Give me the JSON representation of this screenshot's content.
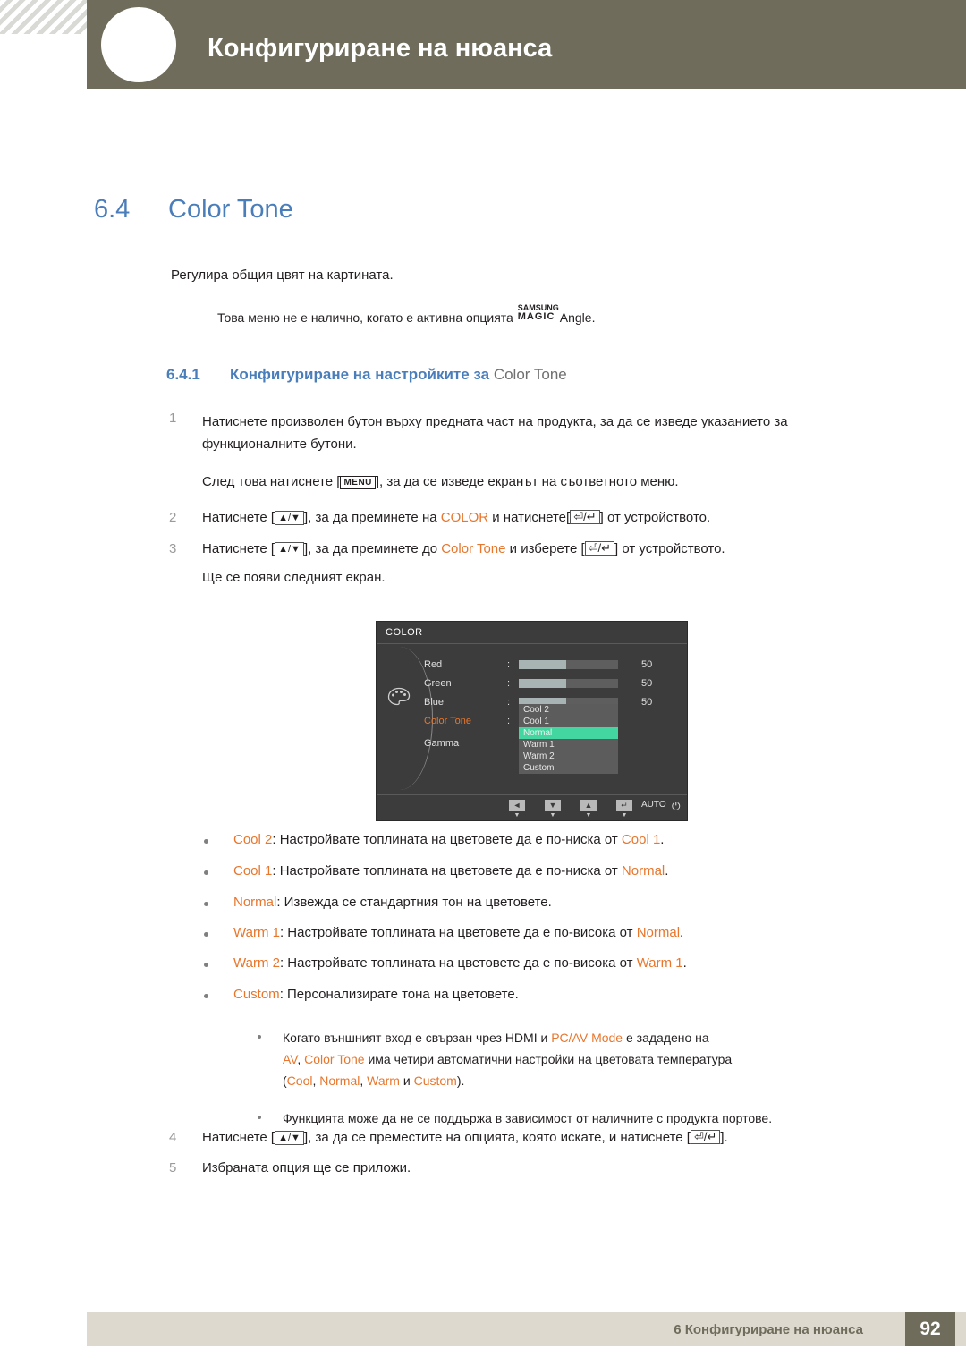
{
  "header": {
    "title": "Конфигуриране на нюанса",
    "icon": "chapter-circle-icon"
  },
  "section": {
    "number": "6.4",
    "title": "Color Tone"
  },
  "intro": "Регулира общия цвят на картината.",
  "note_magic": {
    "before": "Това меню не е налично, когато е активна опцията ",
    "logo_top": "SAMSUNG",
    "logo_bottom": "MAGIC",
    "after": "Angle",
    "period": "."
  },
  "subhead": {
    "number": "6.4.1",
    "bold": "Конфигуриране на настройките за ",
    "plain": "Color Tone"
  },
  "steps": [
    {
      "num": "1",
      "line1": "Натиснете произволен бутон върху предната част на продукта, за да се изведе указанието за",
      "line2": "функционалните бутони.",
      "line3_before": "След това натиснете [",
      "line3_key": "MENU",
      "line3_after": "], за да се изведе екранът на съответното меню."
    },
    {
      "num": "2",
      "before": "Натиснете [",
      "keys": "▲/▼",
      "mid": "], за да преминете на ",
      "highlight": "COLOR",
      "mid2": " и натиснете[",
      "after": "] от устройството."
    },
    {
      "num": "3",
      "before": "Натиснете [",
      "keys": "▲/▼",
      "mid": "], за да преминете до ",
      "highlight": "Color Tone",
      "mid2": " и изберете [",
      "after": "] от устройството.",
      "sub": "Ще се появи следният екран."
    },
    {
      "num": "4",
      "before": "Натиснете [",
      "keys": "▲/▼",
      "mid": "], за да се преместите на опцията, която искате, и натиснете [",
      "after": "]."
    },
    {
      "num": "5",
      "text": "Избраната опция ще се приложи."
    }
  ],
  "osd": {
    "title": "COLOR",
    "icon_name": "palette-icon",
    "rows": [
      {
        "label": "Red",
        "colon": ":",
        "value": "50",
        "fill_pct": 48
      },
      {
        "label": "Green",
        "colon": ":",
        "value": "50",
        "fill_pct": 48
      },
      {
        "label": "Blue",
        "colon": ":",
        "value": "50",
        "fill_pct": 48
      }
    ],
    "selected_label": "Color Tone",
    "selected_colon": ":",
    "last_label": "Gamma",
    "menu_items": [
      "Cool 2",
      "Cool 1",
      "Normal",
      "Warm 1",
      "Warm 2",
      "Custom"
    ],
    "menu_selected_index": 2,
    "footer": {
      "buttons": [
        {
          "glyph": "◄",
          "sub": "▼"
        },
        {
          "glyph": "▼",
          "sub": "▼"
        },
        {
          "glyph": "▲",
          "sub": "▼"
        },
        {
          "glyph": "↵",
          "sub": "▼"
        }
      ],
      "auto_label": "AUTO",
      "power_glyph": "⏻"
    },
    "colors": {
      "background": "#3c3c3c",
      "bar_fill": "#a8b4b4",
      "highlight": "#43d6a0",
      "accent_text": "#e8762c"
    }
  },
  "bullets": [
    {
      "term": "Cool 2",
      "colon": ":",
      "text": " Настройвате топлината на цветовете да е по-ниска от ",
      "ref": "Cool 1",
      "end": "."
    },
    {
      "term": "Cool 1",
      "colon": ":",
      "text": " Настройвате топлината на цветовете да е по-ниска от ",
      "ref": "Normal",
      "end": "."
    },
    {
      "term": "Normal",
      "colon": ":",
      "text": " Извежда се стандартния тон на цветовете.",
      "ref": "",
      "end": ""
    },
    {
      "term": "Warm 1",
      "colon": ":",
      "text": " Настройвате топлината на цветовете да е по-висока от ",
      "ref": "Normal",
      "end": "."
    },
    {
      "term": "Warm 2",
      "colon": ":",
      "text": " Настройвате топлината на цветовете да е по-висока от ",
      "ref": "Warm 1",
      "end": "."
    },
    {
      "term": "Custom",
      "colon": ":",
      "text": " Персонализирате тона на цветовете.",
      "ref": "",
      "end": ""
    }
  ],
  "subbullets": {
    "first": {
      "l1_a": "Когато външният вход е свързан чрез ",
      "l1_hdmi": "HDMI",
      "l1_b": " и ",
      "l1_pcav": "PC/AV Mode",
      "l1_c": " е зададено на",
      "l2_av": "AV",
      "l2_comma": ", ",
      "l2_ct": "Color Tone",
      "l2_rest": " има четири автоматични настройки на цветовата температура",
      "l3_open": "(",
      "l3_cool": "Cool",
      "l3_c1": ", ",
      "l3_normal": "Normal",
      "l3_c2": ", ",
      "l3_warm": "Warm",
      "l3_i": " и ",
      "l3_custom": "Custom",
      "l3_close": ")."
    },
    "second": "Функцията може да не се поддържа в зависимост от наличните с продукта портове."
  },
  "footer": {
    "text": "6 Конфигуриране на нюанса",
    "page": "92"
  }
}
